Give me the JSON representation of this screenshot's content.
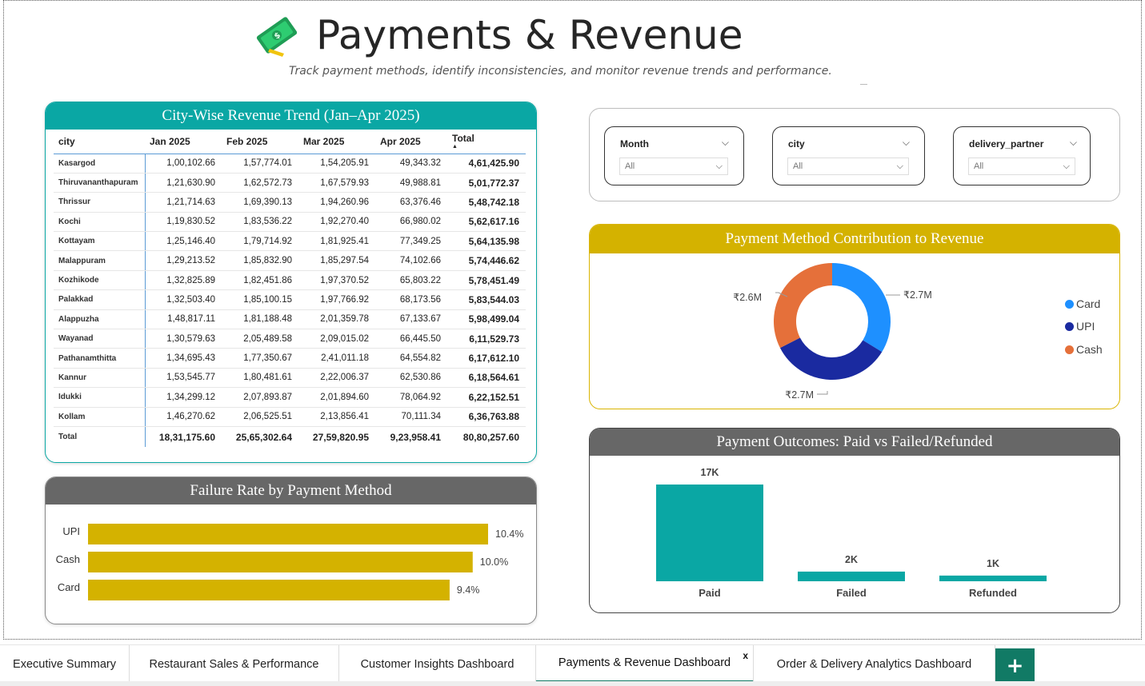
{
  "header": {
    "title": "Payments & Revenue",
    "subtitle": "Track payment methods, identify inconsistencies, and monitor revenue trends and performance.",
    "icon": "money-icon"
  },
  "city_table": {
    "title": "City-Wise Revenue Trend (Jan–Apr 2025)",
    "columns": [
      "city",
      "Jan 2025",
      "Feb 2025",
      "Mar 2025",
      "Apr 2025",
      "Total"
    ],
    "rows": [
      [
        "Kasargod",
        "1,00,102.66",
        "1,57,774.01",
        "1,54,205.91",
        "49,343.32",
        "4,61,425.90"
      ],
      [
        "Thiruvananthapuram",
        "1,21,630.90",
        "1,62,572.73",
        "1,67,579.93",
        "49,988.81",
        "5,01,772.37"
      ],
      [
        "Thrissur",
        "1,21,714.63",
        "1,69,390.13",
        "1,94,260.96",
        "63,376.46",
        "5,48,742.18"
      ],
      [
        "Kochi",
        "1,19,830.52",
        "1,83,536.22",
        "1,92,270.40",
        "66,980.02",
        "5,62,617.16"
      ],
      [
        "Kottayam",
        "1,25,146.40",
        "1,79,714.92",
        "1,81,925.41",
        "77,349.25",
        "5,64,135.98"
      ],
      [
        "Malappuram",
        "1,29,213.52",
        "1,85,832.90",
        "1,85,297.54",
        "74,102.66",
        "5,74,446.62"
      ],
      [
        "Kozhikode",
        "1,32,825.89",
        "1,82,451.86",
        "1,97,370.52",
        "65,803.22",
        "5,78,451.49"
      ],
      [
        "Palakkad",
        "1,32,503.40",
        "1,85,100.15",
        "1,97,766.92",
        "68,173.56",
        "5,83,544.03"
      ],
      [
        "Alappuzha",
        "1,48,817.11",
        "1,81,188.48",
        "2,01,359.78",
        "67,133.67",
        "5,98,499.04"
      ],
      [
        "Wayanad",
        "1,30,579.63",
        "2,05,489.58",
        "2,09,015.02",
        "66,445.50",
        "6,11,529.73"
      ],
      [
        "Pathanamthitta",
        "1,34,695.43",
        "1,77,350.67",
        "2,41,011.18",
        "64,554.82",
        "6,17,612.10"
      ],
      [
        "Kannur",
        "1,53,545.77",
        "1,80,481.61",
        "2,22,006.37",
        "62,530.86",
        "6,18,564.61"
      ],
      [
        "Idukki",
        "1,34,299.12",
        "2,07,893.87",
        "2,01,894.60",
        "78,064.92",
        "6,22,152.51"
      ],
      [
        "Kollam",
        "1,46,270.62",
        "2,06,525.51",
        "2,13,856.41",
        "70,111.34",
        "6,36,763.88"
      ]
    ],
    "total_row": [
      "Total",
      "18,31,175.60",
      "25,65,302.64",
      "27,59,820.95",
      "9,23,958.41",
      "80,80,257.60"
    ]
  },
  "filters": {
    "month": {
      "label": "Month",
      "value": "All"
    },
    "city": {
      "label": "city",
      "value": "All"
    },
    "delivery_partner": {
      "label": "delivery_partner",
      "value": "All"
    }
  },
  "charts": {
    "failure": {
      "title": "Failure Rate by Payment Method"
    },
    "method": {
      "title": "Payment Method Contribution to Revenue"
    },
    "outcomes": {
      "title": "Payment Outcomes: Paid vs Failed/Refunded"
    }
  },
  "chart_data": [
    {
      "type": "bar",
      "orientation": "horizontal",
      "title": "Failure Rate by Payment Method",
      "categories": [
        "UPI",
        "Cash",
        "Card"
      ],
      "values": [
        10.4,
        10.0,
        9.4
      ],
      "labels": [
        "10.4%",
        "10.0%",
        "9.4%"
      ],
      "unit": "%",
      "xlim": [
        0,
        10.4
      ],
      "color": "#d4b200"
    },
    {
      "type": "pie",
      "donut": true,
      "title": "Payment Method Contribution to Revenue",
      "categories": [
        "Card",
        "UPI",
        "Cash"
      ],
      "values": [
        2.7,
        2.7,
        2.6
      ],
      "labels": [
        "₹2.7M",
        "₹2.7M",
        "₹2.6M"
      ],
      "colors": [
        "#1e90ff",
        "#1a2aa0",
        "#e5703a"
      ],
      "legend": "right"
    },
    {
      "type": "bar",
      "title": "Payment Outcomes: Paid vs Failed/Refunded",
      "categories": [
        "Paid",
        "Failed",
        "Refunded"
      ],
      "values": [
        17000,
        1700,
        1000
      ],
      "labels": [
        "17K",
        "2K",
        "1K"
      ],
      "ylim": [
        0,
        17000
      ],
      "color": "#0aa7a4"
    }
  ],
  "tabs": [
    {
      "label": "Executive Summary",
      "active": false
    },
    {
      "label": "Restaurant Sales & Performance",
      "active": false
    },
    {
      "label": "Customer Insights Dashboard",
      "active": false
    },
    {
      "label": "Payments & Revenue Dashboard",
      "active": true
    },
    {
      "label": "Order & Delivery Analytics Dashboard",
      "active": false
    }
  ],
  "tab_close_label": "x",
  "add_tab_label": "+"
}
